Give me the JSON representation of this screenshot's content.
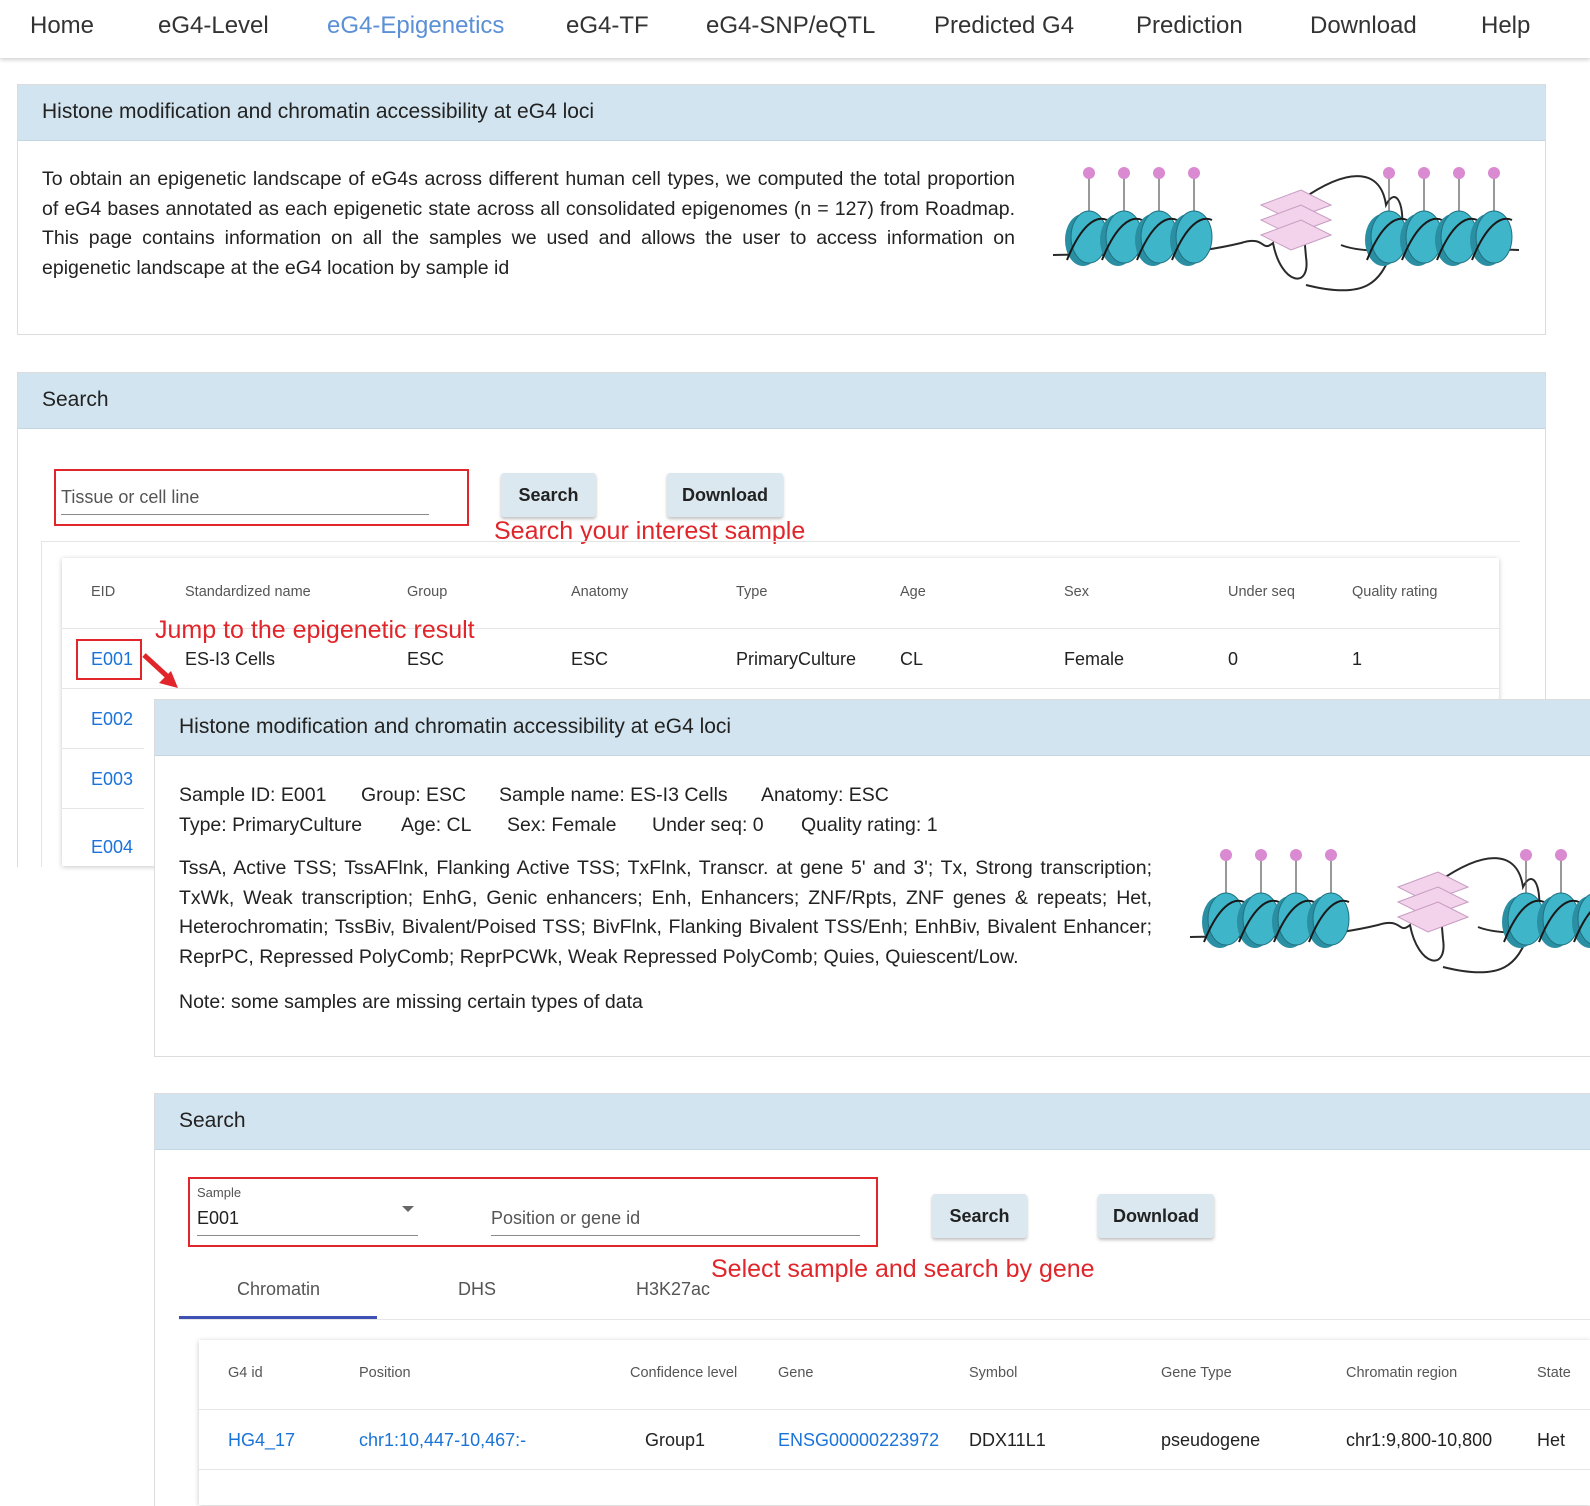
{
  "nav": {
    "items": [
      "Home",
      "eG4-Level",
      "eG4-Epigenetics",
      "eG4-TF",
      "eG4-SNP/eQTL",
      "Predicted G4",
      "Prediction",
      "Download",
      "Help"
    ],
    "active_index": 2,
    "active_color": "#5b8fd6"
  },
  "intro": {
    "title": "Histone modification and chromatin accessibility at eG4 loci",
    "text": "To obtain an epigenetic landscape of eG4s across different human cell types, we computed the total proportion of eG4 bases annotated as each epigenetic state across all consolidated epigenomes (n = 127) from Roadmap. This page contains information on all the samples we used and allows the user to access information on epigenetic landscape at the eG4 location by sample id"
  },
  "search1": {
    "title": "Search",
    "placeholder": "Tissue or cell line",
    "search_label": "Search",
    "download_label": "Download",
    "annotation": "Search your interest sample",
    "annotation2": "Jump to the epigenetic result"
  },
  "samples_table": {
    "headers": [
      "EID",
      "Standardized name",
      "Group",
      "Anatomy",
      "Type",
      "Age",
      "Sex",
      "Under seq",
      "Quality rating"
    ],
    "row": [
      "E001",
      "ES-I3 Cells",
      "ESC",
      "ESC",
      "PrimaryCulture",
      "CL",
      "Female",
      "0",
      "1"
    ],
    "more_ids": [
      "E002",
      "E003",
      "E004"
    ]
  },
  "detail": {
    "title": "Histone modification and chromatin accessibility at eG4 loci",
    "line1": [
      "Sample ID: E001",
      "Group: ESC",
      "Sample name: ES-I3 Cells",
      "Anatomy: ESC"
    ],
    "line2": [
      "Type: PrimaryCulture",
      "Age: CL",
      "Sex: Female",
      "Under seq: 0",
      "Quality rating: 1"
    ],
    "legend": "TssA, Active TSS; TssAFlnk, Flanking Active TSS; TxFlnk, Transcr. at gene 5' and 3'; Tx, Strong transcription; TxWk, Weak transcription; EnhG, Genic enhancers; Enh, Enhancers; ZNF/Rpts, ZNF genes & repeats; Het, Heterochromatin; TssBiv, Bivalent/Poised TSS; BivFlnk, Flanking Bivalent TSS/Enh; EnhBiv, Bivalent Enhancer; ReprPC, Repressed PolyComb; ReprPCWk, Weak Repressed PolyComb; Quies, Quiescent/Low.",
    "note": "Note: some samples are missing certain types of data"
  },
  "search2": {
    "title": "Search",
    "sample_label": "Sample",
    "sample_value": "E001",
    "position_placeholder": "Position or gene id",
    "search_label": "Search",
    "download_label": "Download",
    "annotation": "Select sample and search by gene",
    "tabs": [
      "Chromatin",
      "DHS",
      "H3K27ac"
    ],
    "active_tab": 0,
    "tab_indicator_color": "#3f51b5"
  },
  "results_table": {
    "headers": [
      "G4 id",
      "Position",
      "Confidence level",
      "Gene",
      "Symbol",
      "Gene Type",
      "Chromatin region",
      "State"
    ],
    "row": [
      "HG4_17",
      "chr1:10,447-10,467:-",
      "Group1",
      "ENSG00000223972",
      "DDX11L1",
      "pseudogene",
      "chr1:9,800-10,800",
      "Het"
    ]
  },
  "colors": {
    "header_bg": "#d2e4ef",
    "annotation_red": "#e0262b",
    "link_blue": "#1a73d9",
    "nucleosome": "#3fb5c9",
    "histone_tail": "#d98ad0"
  }
}
